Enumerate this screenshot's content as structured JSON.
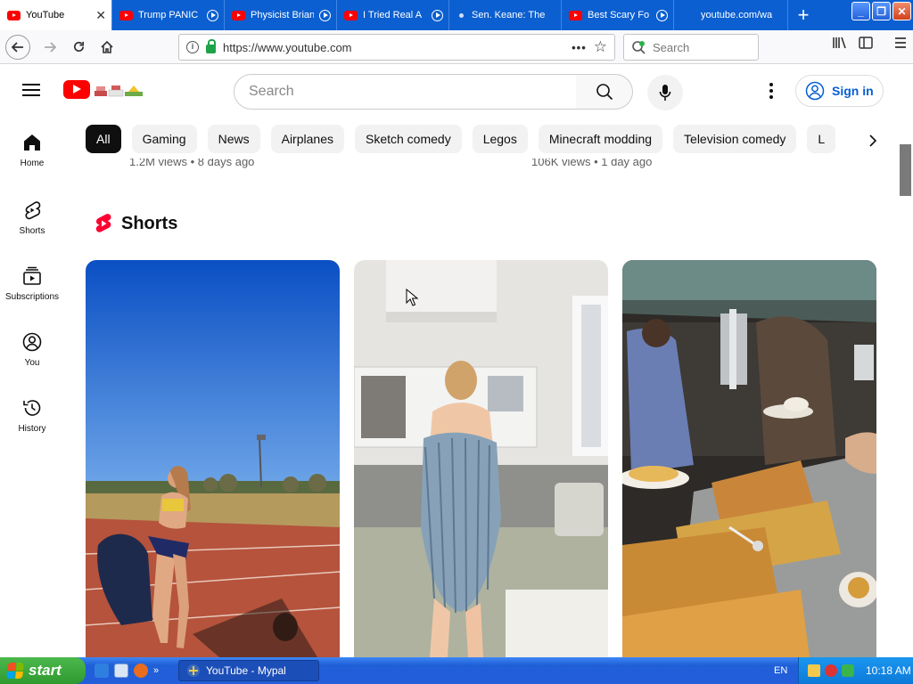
{
  "browser": {
    "tabs": [
      {
        "title": "YouTube",
        "active": true,
        "icon": "youtube-icon"
      },
      {
        "title": "Trump PANIC",
        "active": false,
        "icon": "youtube-icon"
      },
      {
        "title": "Physicist Brian",
        "active": false,
        "icon": "youtube-icon"
      },
      {
        "title": "I Tried Real A",
        "active": false,
        "icon": "youtube-icon"
      },
      {
        "title": "Sen. Keane: The",
        "active": false,
        "icon": "dot-icon"
      },
      {
        "title": "Best Scary Fo",
        "active": false,
        "icon": "youtube-icon"
      },
      {
        "title": "youtube.com/wa",
        "active": false,
        "icon": "none"
      }
    ],
    "url": "https://www.youtube.com",
    "search_placeholder": "Search"
  },
  "youtube": {
    "search_placeholder": "Search",
    "signin_label": "Sign in",
    "sidebar": [
      {
        "label": "Home",
        "icon": "home-icon"
      },
      {
        "label": "Shorts",
        "icon": "shorts-icon"
      },
      {
        "label": "Subscriptions",
        "icon": "subscriptions-icon"
      },
      {
        "label": "You",
        "icon": "you-icon"
      },
      {
        "label": "History",
        "icon": "history-icon"
      }
    ],
    "chips": [
      "All",
      "Gaming",
      "News",
      "Airplanes",
      "Sketch comedy",
      "Legos",
      "Minecraft modding",
      "Television comedy",
      "L"
    ],
    "partial_views": [
      "1.2M views • 8 days ago",
      "106K views • 1 day ago"
    ],
    "shorts_title": "Shorts"
  },
  "taskbar": {
    "start_label": "start",
    "task_label": "YouTube - Mypal",
    "lang": "EN",
    "time": "10:18 AM"
  },
  "colors": {
    "yt_red": "#ff0000",
    "link_blue": "#065fd4",
    "tabstrip_blue": "#0b5fd0"
  }
}
